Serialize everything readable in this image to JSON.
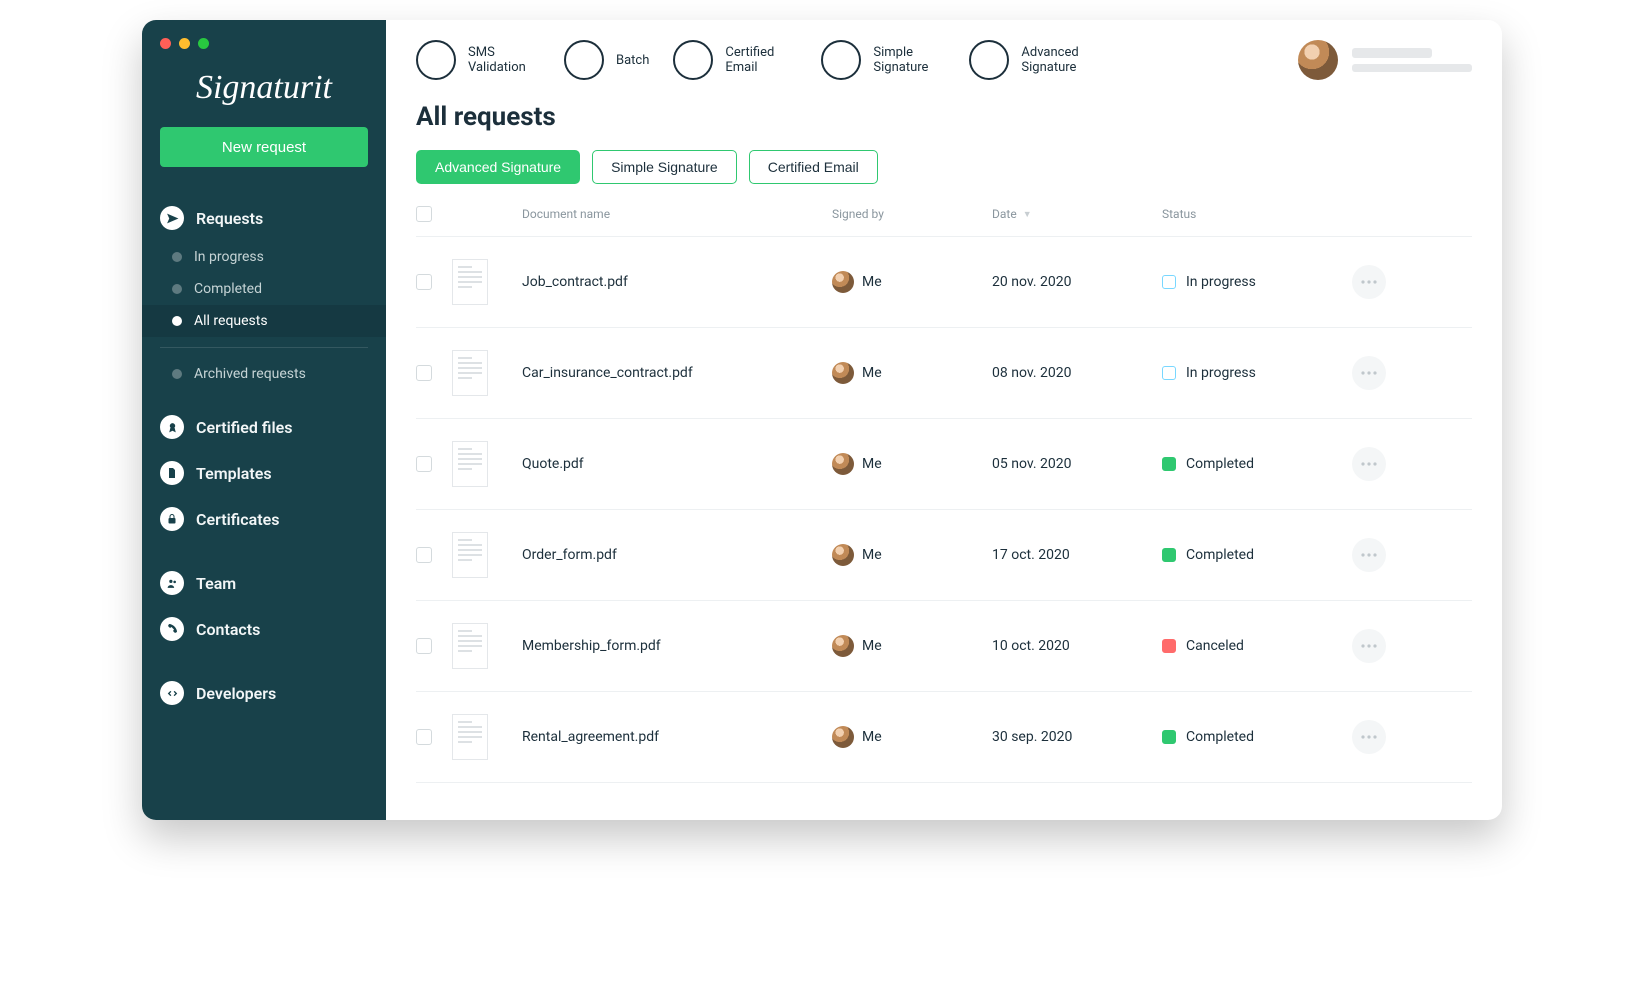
{
  "brand": "Signaturit",
  "sidebar": {
    "new_request_label": "New request",
    "requests_label": "Requests",
    "subs": [
      {
        "label": "In progress"
      },
      {
        "label": "Completed"
      },
      {
        "label": "All requests"
      },
      {
        "label": "Archived requests"
      }
    ],
    "items": [
      {
        "label": "Certified files"
      },
      {
        "label": "Templates"
      },
      {
        "label": "Certificates"
      },
      {
        "label": "Team"
      },
      {
        "label": "Contacts"
      },
      {
        "label": "Developers"
      }
    ]
  },
  "topbar": {
    "actions": [
      {
        "label": "SMS Validation"
      },
      {
        "label": "Batch"
      },
      {
        "label": "Certified Email"
      },
      {
        "label": "Simple Signature"
      },
      {
        "label": "Advanced Signature"
      }
    ]
  },
  "page": {
    "title": "All requests"
  },
  "filters": {
    "pills": [
      {
        "label": "Advanced Signature",
        "active": true
      },
      {
        "label": "Simple Signature",
        "active": false
      },
      {
        "label": "Certified Email",
        "active": false
      }
    ]
  },
  "table": {
    "headers": {
      "doc": "Document name",
      "signed_by": "Signed by",
      "date": "Date",
      "status": "Status"
    },
    "rows": [
      {
        "name": "Job_contract.pdf",
        "signer": "Me",
        "date": "20 nov. 2020",
        "status_label": "In progress",
        "status": "progress"
      },
      {
        "name": "Car_insurance_contract.pdf",
        "signer": "Me",
        "date": "08 nov. 2020",
        "status_label": "In progress",
        "status": "progress"
      },
      {
        "name": "Quote.pdf",
        "signer": "Me",
        "date": "05 nov. 2020",
        "status_label": "Completed",
        "status": "completed"
      },
      {
        "name": "Order_form.pdf",
        "signer": "Me",
        "date": "17 oct. 2020",
        "status_label": "Completed",
        "status": "completed"
      },
      {
        "name": "Membership_form.pdf",
        "signer": "Me",
        "date": "10 oct. 2020",
        "status_label": "Canceled",
        "status": "canceled"
      },
      {
        "name": "Rental_agreement.pdf",
        "signer": "Me",
        "date": "30 sep. 2020",
        "status_label": "Completed",
        "status": "completed"
      }
    ]
  }
}
